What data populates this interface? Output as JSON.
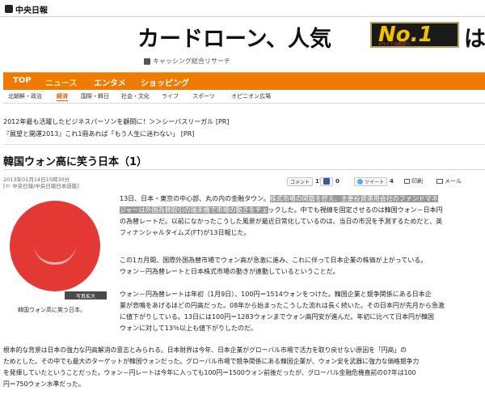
{
  "site": {
    "logo_text": "中央日報"
  },
  "ad": {
    "main": "カードローン、人気",
    "badge": "No.1",
    "badge_sub": "※サイト比較調べ",
    "tail": "は？",
    "sub": "キャッシング総合リサーチ"
  },
  "nav": {
    "items": [
      "TOP",
      "ニュース",
      "エンタメ",
      "ショッピング"
    ],
    "active": "ニュース"
  },
  "subnav": {
    "items": [
      "北朝鮮・政治",
      "経済",
      "国際・韓日",
      "社会・文化",
      "ライフ",
      "スポーツ",
      "オピニオン広場"
    ],
    "active": "経済"
  },
  "pr_links": [
    "2012年最も活躍したビジネスパーソンを顧問に！＞＞シーバスリーガル",
    "『展望と開運2013』これ1冊あれば「もう人生に迷わない」"
  ],
  "pr_tag": "[PR]",
  "article": {
    "headline": "韓国ウォン高に笑う日本（1）",
    "date": "2013年01月14日15時30分",
    "source": "[© 中央日報/中央日報日本語版]",
    "comment_label": "コメント",
    "comment_count": "17",
    "fb_count": "0",
    "tweet_label": "ツイート",
    "tweet_count": "4",
    "print_label": "印刷",
    "mail_label": "メール",
    "photo_button": "写真拡大",
    "photo_caption": "韓国ウォン高に笑う日本。",
    "p1": [
      {
        "pre": "13日、日本・東京の中心部、丸の内の金融タウン。",
        "hl": "株式市場の閑散を控え、主要投資運用会社のファンドマネ"
      },
      {
        "hl": "ジャーは外国為替取引の端末機で市場の動きをチェ",
        "post": "ックした。中でも視線を固定させるのは韓国ウォン－日本円"
      },
      {
        "post": "の為替レートだ。以前になかったこうした風景が最近日常化しているのは、当日の市況を予測するためだと、英"
      },
      {
        "post": "フィナンシャルタイムズ(FT)が13日報じた。"
      }
    ],
    "p2": [
      "この1カ月間、国際外国為替市場でウォン高が急激に進み、これに伴って日本企業の株価が上がっている。",
      "ウォン－円為替レートと日本株式市場の動きが連動しているということだ。"
    ],
    "p3": [
      "ウォン－円為替レートは年初（1月9日）、100円＝1514ウォンをつけた。韓国企業と競争関係にある日本企",
      "業が悲鳴をあげるほどの円高だった。08年から始まったこうした流れは長く続いた。その日本円が先月から急激",
      "に値下がりしている。13日には100円＝1283ウォンまでウォン高円安が進んだ。年初に比べて日本円が韓国",
      "ウォンに対して13％以上も値下がりしたのだ。"
    ],
    "p4": [
      "根本的な背景は日本の強力な円高解消の意志とみられる。日本財界は今年、日本企業がグローバル市場で活力を取り戻せない原因を「円高」の",
      "ためとした。その中でも最大のターゲットが韓国ウォンだった。グローバル市場で競争関係にある韓国企業が、ウォン安を武器に強力な価格競争力",
      "を発揮していたということだった。ウォン－円レートは今年に入っても100円＝1500ウォン前後だったが、グローバル金融危機直前の07年は100",
      "円＝750ウォン水準だった。"
    ]
  }
}
